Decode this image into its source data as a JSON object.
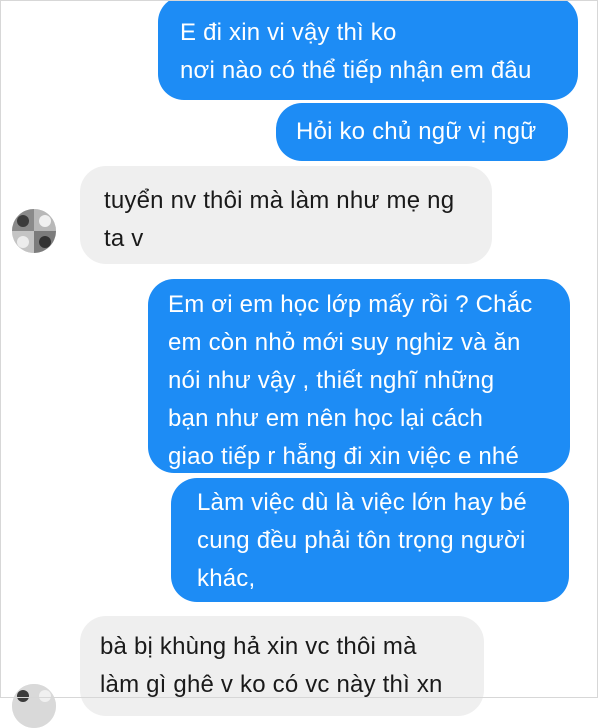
{
  "messages": [
    {
      "id": "m1",
      "side": "out",
      "text": "E đi xin vi           vậy thì ko\nnơi nào có thể tiếp nhận em đâu"
    },
    {
      "id": "m2",
      "side": "out",
      "text": "Hỏi ko chủ ngữ vị ngữ"
    },
    {
      "id": "m3",
      "side": "in",
      "text": "tuyển nv thôi mà làm như mẹ ng\nta v"
    },
    {
      "id": "m4",
      "side": "out",
      "text": "Em ơi em học lớp mấy rồi ? Chắc\nem còn nhỏ mới suy nghiz và ăn\nnói như vậy , thiết nghĩ những\nbạn như em nên học lại cách\ngiao tiếp r hẵng đi xin việc e nhé"
    },
    {
      "id": "m5",
      "side": "out",
      "text": "Làm việc dù là việc lớn hay bé\ncung đều phải tôn trọng người\nkhác,"
    },
    {
      "id": "m6",
      "side": "in",
      "text": "bà bị khùng hả xin vc thôi mà\nlàm gì ghê v ko có vc này thì xn"
    }
  ],
  "icons": {
    "sticker": "emoji-face-icon",
    "contact_avatar": "contact-avatar"
  },
  "colors": {
    "outgoing_bubble": "#1d8cf5",
    "incoming_bubble": "#efefef",
    "sticker_yellow": "#f7c948"
  }
}
